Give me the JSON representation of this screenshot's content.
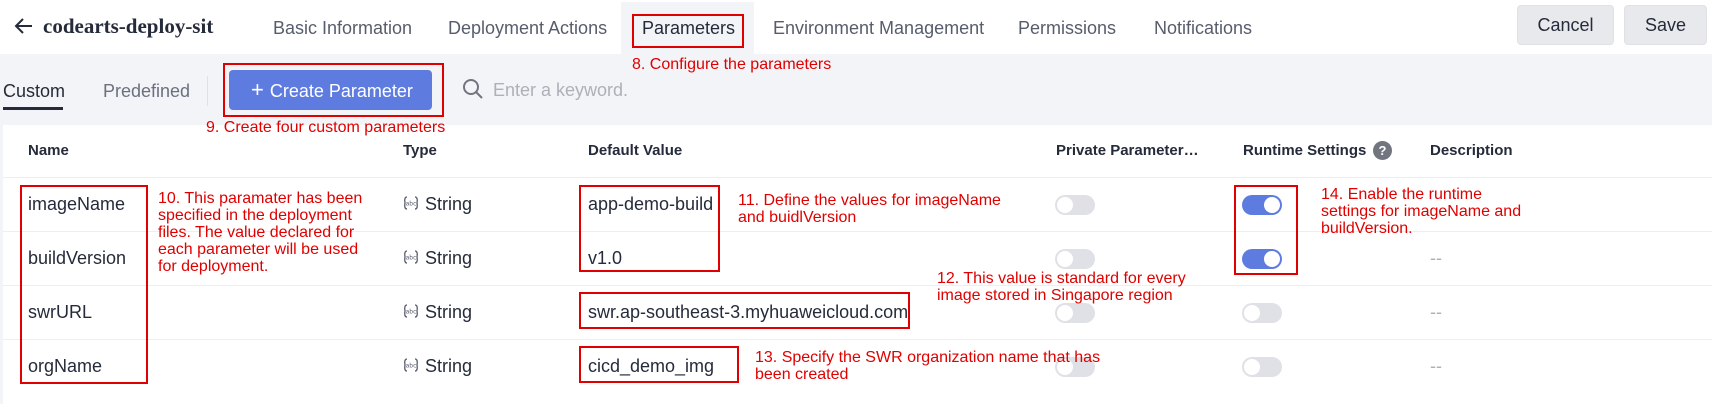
{
  "header": {
    "title": "codearts-deploy-sit",
    "tabs": [
      {
        "label": "Basic Information"
      },
      {
        "label": "Deployment Actions"
      },
      {
        "label": "Parameters"
      },
      {
        "label": "Environment Management"
      },
      {
        "label": "Permissions"
      },
      {
        "label": "Notifications"
      }
    ],
    "active_tab": "Parameters",
    "cancel_label": "Cancel",
    "save_label": "Save"
  },
  "subtabs": {
    "custom": "Custom",
    "predefined": "Predefined",
    "active": "Custom"
  },
  "create_button": {
    "plus": "+",
    "label": "Create Parameter"
  },
  "search": {
    "placeholder": "Enter a keyword."
  },
  "table": {
    "columns": {
      "name": "Name",
      "type": "Type",
      "default_value": "Default Value",
      "private": "Private Parameter…",
      "runtime": "Runtime Settings",
      "description": "Description"
    },
    "rows": [
      {
        "name": "imageName",
        "type": "String",
        "default_value": "app-demo-build",
        "private": false,
        "runtime": true,
        "description": ""
      },
      {
        "name": "buildVersion",
        "type": "String",
        "default_value": "v1.0",
        "private": false,
        "runtime": true,
        "description": "--"
      },
      {
        "name": "swrURL",
        "type": "String",
        "default_value": "swr.ap-southeast-3.myhuaweicloud.com",
        "private": false,
        "runtime": false,
        "description": "--"
      },
      {
        "name": "orgName",
        "type": "String",
        "default_value": "cicd_demo_img",
        "private": false,
        "runtime": false,
        "description": "--"
      }
    ]
  },
  "annotations": {
    "a8": "8. Configure the parameters",
    "a9": "9. Create four custom parameters",
    "a10": [
      "10. This paramater has been",
      "specified in the deployment",
      "files. The value declared for",
      "each parameter will be used",
      "for deployment."
    ],
    "a11": [
      "11. Define the values for imageName",
      "and buidlVersion"
    ],
    "a12": [
      "12. This value is standard for every",
      "image stored in Singapore region"
    ],
    "a13": [
      "13. Specify the SWR organization name that has",
      "been created"
    ],
    "a14": [
      "14. Enable the runtime",
      "settings for imageName and",
      "buildVersion."
    ]
  },
  "colors": {
    "accent": "#5e7ce0",
    "annotation": "#e00000",
    "background": "#f3f4f7"
  },
  "icons": [
    "back-arrow-icon",
    "plus-icon",
    "search-icon",
    "help-icon",
    "string-type-icon"
  ]
}
